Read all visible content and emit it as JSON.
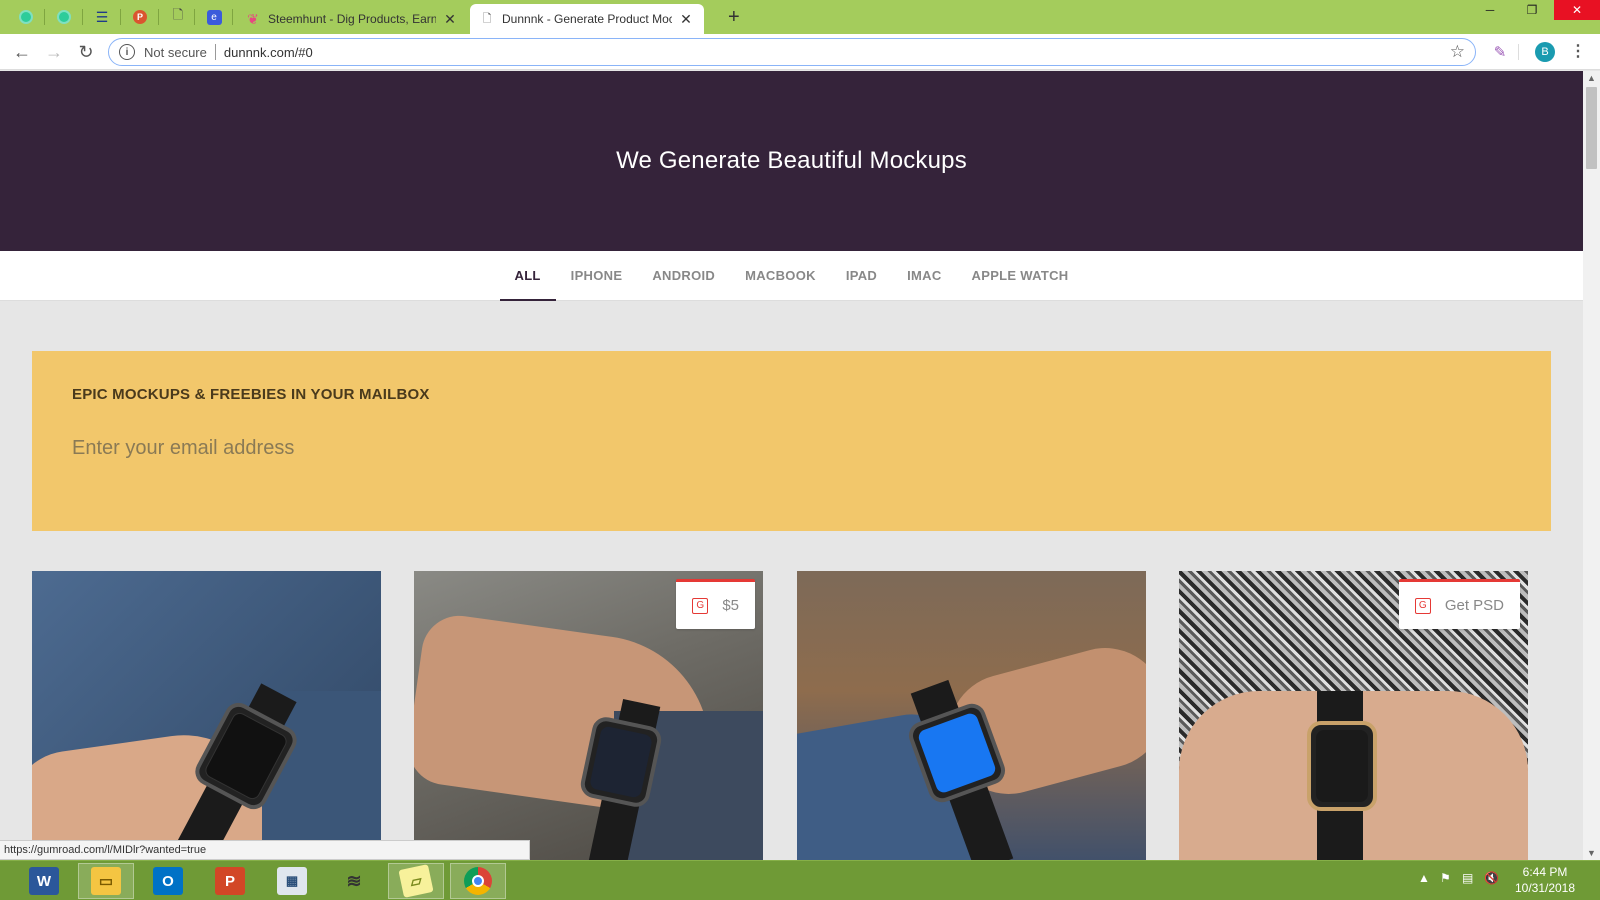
{
  "browser": {
    "tabs": [
      {
        "title": "Steemhunt - Dig Products, Earn S",
        "active": false
      },
      {
        "title": "Dunnnk - Generate Product Moc",
        "active": true
      }
    ],
    "omnibox": {
      "security": "Not secure",
      "url": "dunnnk.com/#0"
    },
    "profile_initial": "B",
    "status_url": "https://gumroad.com/l/MIDlr?wanted=true"
  },
  "hero": {
    "title": "We Generate Beautiful Mockups"
  },
  "categories": [
    {
      "label": "ALL",
      "active": true
    },
    {
      "label": "IPHONE",
      "active": false
    },
    {
      "label": "ANDROID",
      "active": false
    },
    {
      "label": "MACBOOK",
      "active": false
    },
    {
      "label": "IPAD",
      "active": false
    },
    {
      "label": "IMAC",
      "active": false
    },
    {
      "label": "APPLE WATCH",
      "active": false
    }
  ],
  "signup": {
    "heading": "EPIC MOCKUPS & FREEBIES IN YOUR MAILBOX",
    "placeholder": "Enter your email address"
  },
  "cards": [
    {
      "badge": ""
    },
    {
      "badge": "$5"
    },
    {
      "badge": ""
    },
    {
      "badge": "Get PSD"
    }
  ],
  "taskbar": {
    "time": "6:44 PM",
    "date": "10/31/2018"
  },
  "colors": {
    "tabstrip": "#a4cc5c",
    "hero": "#35233a",
    "signup": "#f2c76b",
    "taskbar": "#6f9a36",
    "badge_accent": "#e53935"
  }
}
